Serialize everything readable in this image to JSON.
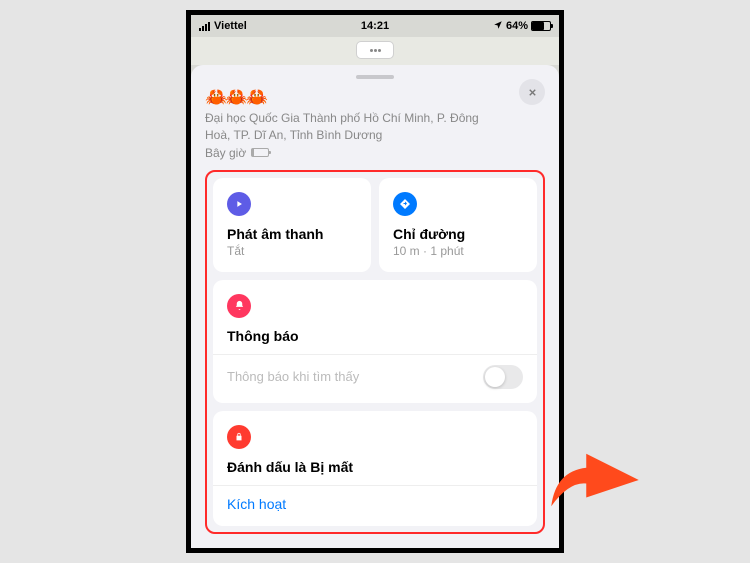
{
  "statusbar": {
    "carrier": "Viettel",
    "time": "14:21",
    "battery": "64%"
  },
  "header": {
    "emoji": "🦀🦀🦀",
    "address": "Đại học Quốc Gia Thành phố Hồ Chí Minh, P. Đông Hoà, TP. Dĩ An, Tỉnh Bình Dương",
    "battery_label": "Bây giờ"
  },
  "cards": {
    "play_sound": {
      "title": "Phát âm thanh",
      "sub": "Tắt"
    },
    "directions": {
      "title": "Chỉ đường",
      "sub": "10 m · 1 phút"
    },
    "notifications": {
      "title": "Thông báo",
      "toggle_label": "Thông báo khi tìm thấy"
    },
    "lost": {
      "title": "Đánh dấu là Bị mất",
      "action": "Kích hoạt"
    }
  }
}
